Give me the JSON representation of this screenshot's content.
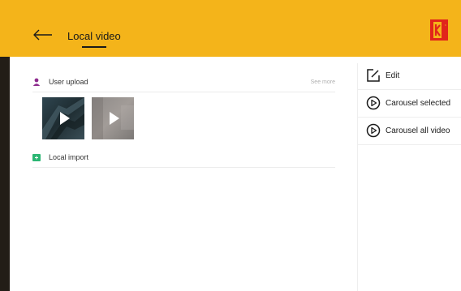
{
  "header": {
    "title": "Local video",
    "brand_color": "#f4b41a",
    "logo": "kodak-logo",
    "back_icon": "back-arrow-icon"
  },
  "main": {
    "sections": [
      {
        "label": "User upload",
        "icon": "user-icon",
        "icon_color": "#8e2c8e",
        "see_more": "See more",
        "thumbnails": [
          {
            "name": "video-thumb-1",
            "icon": "play-icon"
          },
          {
            "name": "video-thumb-2",
            "icon": "play-icon"
          }
        ]
      },
      {
        "label": "Local import",
        "icon": "folder-icon",
        "icon_color": "#2bb673"
      }
    ]
  },
  "side_menu": [
    {
      "label": "Edit",
      "icon": "edit-icon"
    },
    {
      "label": "Carousel selected",
      "icon": "play-circle-icon"
    },
    {
      "label": "Carousel all video",
      "icon": "play-circle-icon"
    }
  ]
}
